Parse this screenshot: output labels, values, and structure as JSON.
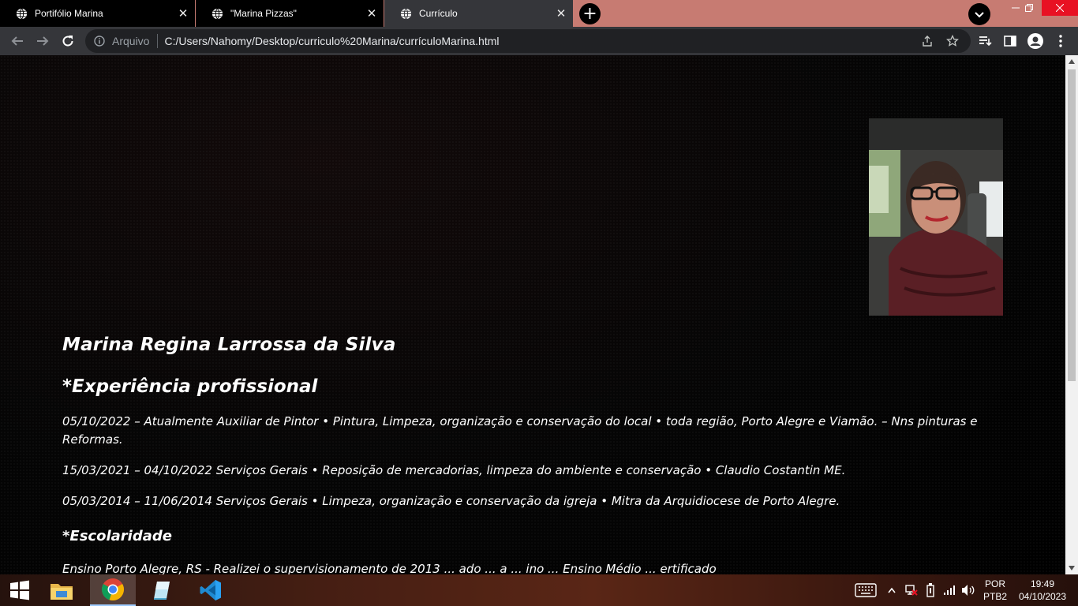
{
  "browser": {
    "tabs": [
      {
        "title": "Portifólio Marina",
        "active": false
      },
      {
        "title": "\"Marina Pizzas\"",
        "active": false
      },
      {
        "title": "Currículo",
        "active": true
      }
    ],
    "address_bar": {
      "scheme_label": "Arquivo",
      "url": "C:/Users/Nahomy/Desktop/curriculo%20Marina/currículoMarina.html"
    },
    "icons": {
      "back": "arrow-left-icon",
      "forward": "arrow-right-icon",
      "reload": "reload-icon",
      "info": "info-icon",
      "share": "share-icon",
      "bookmark": "star-icon",
      "reading_list": "reading-list-icon",
      "side_panel": "side-panel-icon",
      "profile": "profile-icon",
      "menu": "kebab-menu-icon"
    }
  },
  "page": {
    "name": "Marina Regina Larrossa da Silva",
    "experience_title": "*Experiência profissional",
    "jobs": [
      "05/10/2022 – Atualmente Auxiliar de Pintor • Pintura, Limpeza, organização e conservação do local • toda região, Porto Alegre e Viamão. – Nns pinturas e Reformas.",
      "15/03/2021 – 04/10/2022 Serviços Gerais • Reposição de mercadorias, limpeza do ambiente e conservação • Claudio Costantin ME.",
      "05/03/2014 – 11/06/2014 Serviços Gerais • Limpeza, organização e conservação da igreja • Mitra da Arquidiocese de Porto Alegre."
    ],
    "education_title": "*Escolaridade",
    "education_partial": "Ensino Porto Alegre, RS - Realizei o supervisionamento de 2013 ... ado ... a ... ino ... Ensino Médio ... ertificado"
  },
  "taskbar": {
    "apps": [
      "windows-start-icon",
      "file-explorer-icon",
      "chrome-icon",
      "notepad-icon",
      "vscode-icon"
    ],
    "language": {
      "line1": "POR",
      "line2": "PTB2"
    },
    "time": "19:49",
    "date": "04/10/2023"
  },
  "colors": {
    "tabstrip": "#c77b72",
    "toolbar": "#35363a",
    "omnibox": "#202124",
    "close_button": "#e81123",
    "page_bg": "#000000",
    "text": "#ffffff"
  }
}
